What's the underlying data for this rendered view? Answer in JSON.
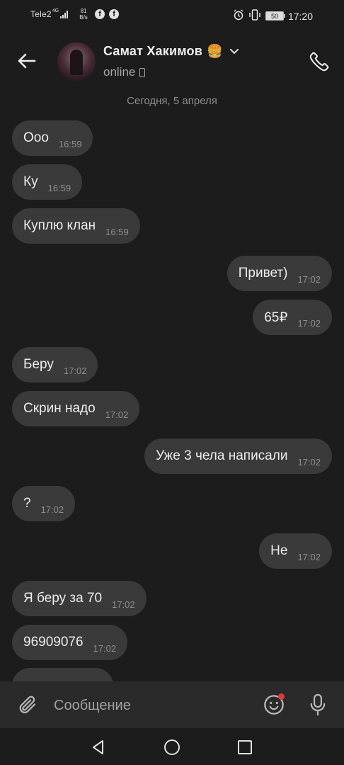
{
  "status_bar": {
    "carrier": "Tele2",
    "network": "4G",
    "speed_value": "81",
    "speed_unit": "B/s",
    "battery": "50",
    "time": "17:20",
    "icons": [
      "signal-icon",
      "facebook-icon",
      "facebook-icon",
      "alarm-icon",
      "vibrate-icon",
      "battery-icon"
    ]
  },
  "header": {
    "contact_name": "Самат Хакимов",
    "name_emoji": "🍔",
    "status": "online",
    "icons": [
      "back-arrow-icon",
      "chevron-down-icon",
      "mobile-device-icon",
      "phone-icon"
    ]
  },
  "chat": {
    "date_separator": "Сегодня, 5 апреля",
    "messages": [
      {
        "direction": "in",
        "text": "Ооо",
        "time": "16:59"
      },
      {
        "direction": "in",
        "text": "Ку",
        "time": "16:59"
      },
      {
        "direction": "in",
        "text": "Куплю клан",
        "time": "16:59"
      },
      {
        "direction": "out",
        "text": "Привет)",
        "time": "17:02"
      },
      {
        "direction": "out",
        "text": "65₽",
        "time": "17:02"
      },
      {
        "direction": "in",
        "text": "Беру",
        "time": "17:02"
      },
      {
        "direction": "in",
        "text": "Скрин надо",
        "time": "17:02"
      },
      {
        "direction": "out",
        "text": "Уже 3 чела написали",
        "time": "17:02"
      },
      {
        "direction": "in",
        "text": "?",
        "time": "17:02"
      },
      {
        "direction": "out",
        "text": "Не",
        "time": "17:02"
      },
      {
        "direction": "in",
        "text": "Я беру за 70",
        "time": "17:02"
      },
      {
        "direction": "in",
        "text": "96909076",
        "time": "17:02"
      },
      {
        "direction": "in",
        "text": "",
        "time": ""
      }
    ]
  },
  "composer": {
    "placeholder": "Сообщение",
    "icons": [
      "paperclip-icon",
      "emoji-icon",
      "microphone-icon"
    ]
  },
  "nav": {
    "icons": [
      "back-triangle-icon",
      "home-circle-icon",
      "recents-square-icon"
    ]
  },
  "colors": {
    "background": "#1c1c1c",
    "bubble": "#3a3a3a",
    "composer": "#2a2a2a",
    "notification_dot": "#e03a3a"
  }
}
